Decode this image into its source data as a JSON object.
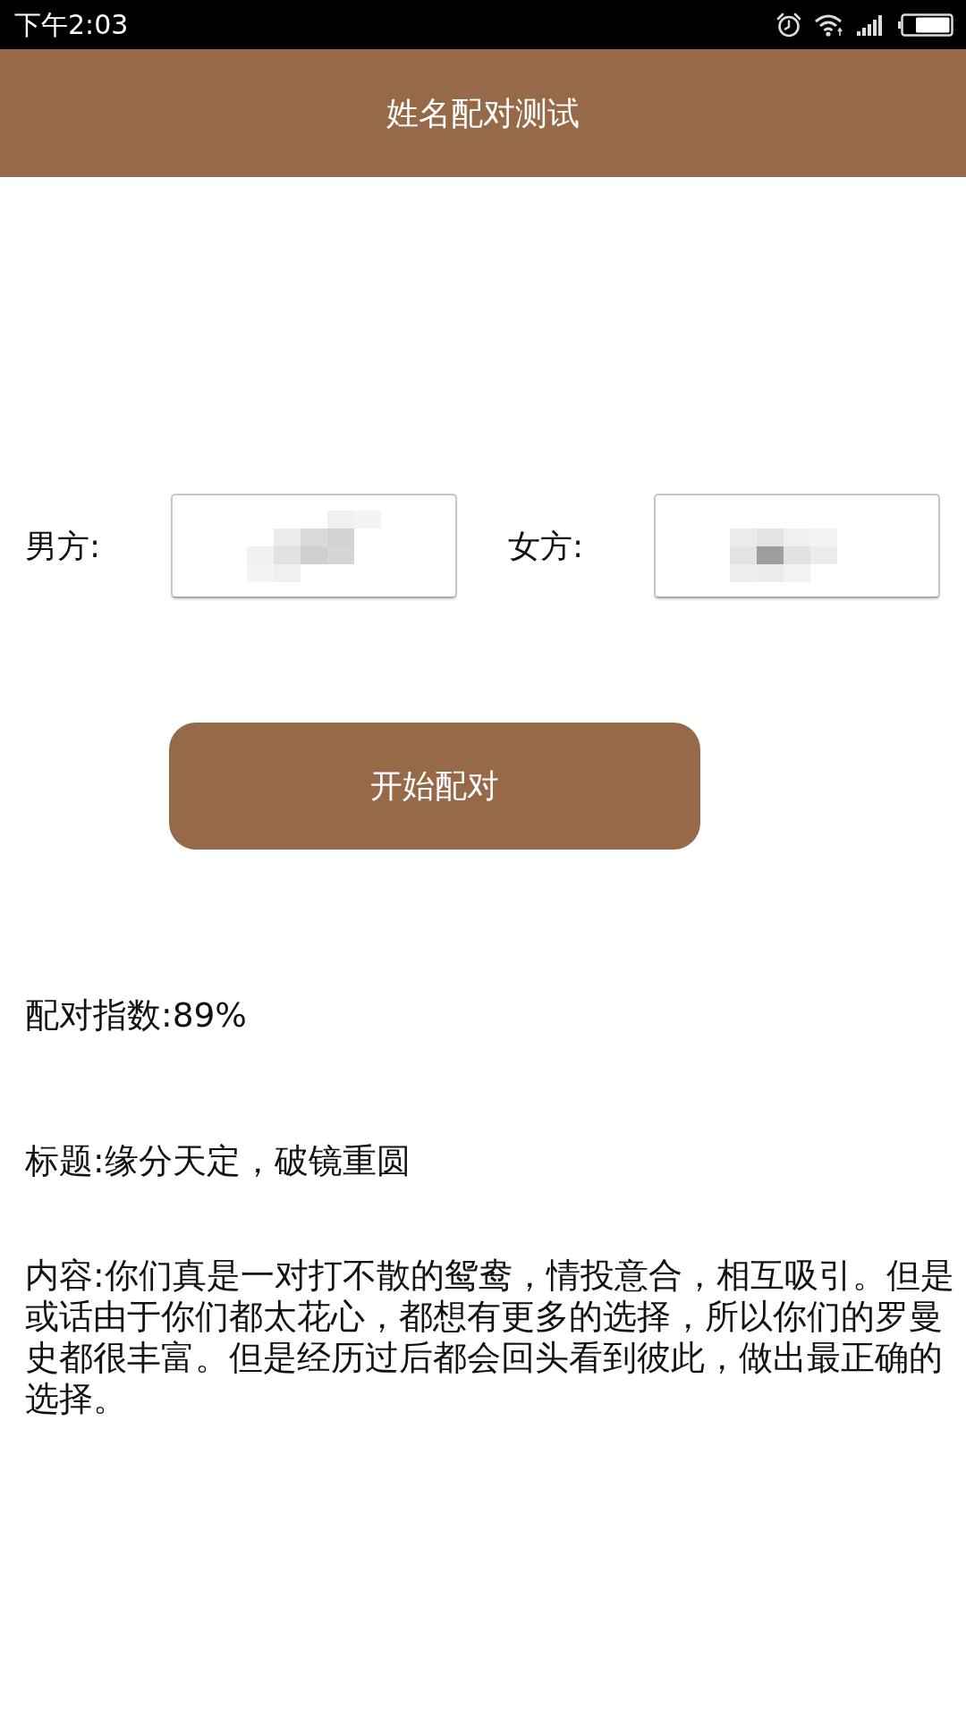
{
  "status_bar": {
    "time": "下午2:03"
  },
  "header": {
    "title": "姓名配对测试"
  },
  "form": {
    "fields": [
      {
        "label": "男方:",
        "obscured": true
      },
      {
        "label": "女方:",
        "obscured": true
      }
    ],
    "button": "开始配对"
  },
  "result": {
    "score": "配对指数:89%",
    "title": "标题:缘分天定，破镜重圆",
    "content": "内容:你们真是一对打不散的鸳鸯，情投意合，相互吸引。但是或话由于你们都太花心，都想有更多的选择，所以你们的罗曼史都很丰富。但是经历过后都会回头看到彼此，做出最正确的选择。"
  }
}
